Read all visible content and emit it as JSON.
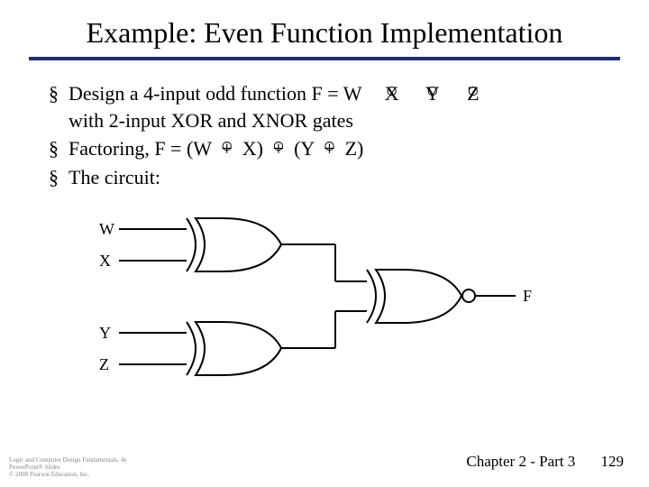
{
  "title": "Example: Even Function Implementation",
  "bullets": {
    "b1_a": "Design a 4-input odd function  F = W",
    "b1_x": "X",
    "b1_y": "Y",
    "b1_z": "Z",
    "b1_b": "with 2-input XOR  and XNOR gates",
    "b2_a": "Factoring,  F = (W ",
    "b2_x": "X) ",
    "b2_m": "(Y ",
    "b2_z": "Z)",
    "b3": "The circuit:"
  },
  "labels": {
    "W": "W",
    "X": "X",
    "Y": "Y",
    "Z": "Z",
    "F": "F"
  },
  "footer": {
    "chapter": "Chapter 2 - Part 3",
    "page": "129",
    "copy1": "Logic and Computer Design Fundamentals, 4e",
    "copy2": "PowerPoint® Slides",
    "copy3": "© 2008 Pearson Education, Inc."
  },
  "glyph": {
    "plus": "+",
    "ring": "○"
  },
  "chart_data": {
    "type": "diagram",
    "description": "Logic circuit: two 2-input XOR gates feeding one 2-input XNOR gate",
    "gates": [
      {
        "id": "G1",
        "type": "XOR",
        "inputs": [
          "W",
          "X"
        ],
        "output": "n1"
      },
      {
        "id": "G2",
        "type": "XOR",
        "inputs": [
          "Y",
          "Z"
        ],
        "output": "n2"
      },
      {
        "id": "G3",
        "type": "XNOR",
        "inputs": [
          "n1",
          "n2"
        ],
        "output": "F"
      }
    ],
    "inputs": [
      "W",
      "X",
      "Y",
      "Z"
    ],
    "outputs": [
      "F"
    ]
  }
}
